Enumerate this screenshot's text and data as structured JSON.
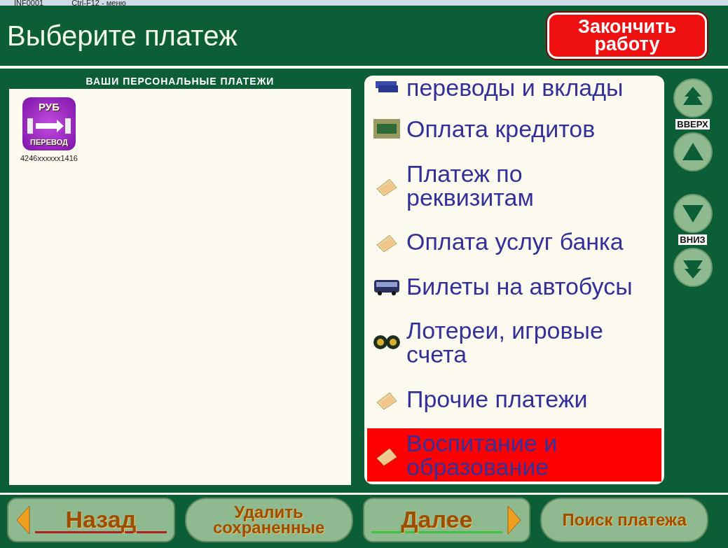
{
  "titlebar": {
    "app": "INF0001",
    "hint": "Ctrl-F12 - меню"
  },
  "header": {
    "title": "Выберите платеж",
    "finish_button": "Закончить работу"
  },
  "personal": {
    "title": "ВАШИ ПЕРСОНАЛЬНЫЕ ПЛАТЕЖИ",
    "items": [
      {
        "badge_top": "РУБ",
        "badge_bottom": "ПЕРЕВОД",
        "caption": "4246xxxxxx1416"
      }
    ]
  },
  "categories": [
    {
      "label": "переводы и вклады",
      "kind": "cards",
      "selected": false
    },
    {
      "label": "Оплата кредитов",
      "kind": "money",
      "selected": false
    },
    {
      "label": "Платеж по реквизитам",
      "kind": "folder",
      "selected": false
    },
    {
      "label": "Оплата услуг банка",
      "kind": "folder",
      "selected": false
    },
    {
      "label": "Билеты на автобусы",
      "kind": "bus",
      "selected": false
    },
    {
      "label": "Лотереи, игровые счета",
      "kind": "lottery",
      "selected": false
    },
    {
      "label": "Прочие платежи",
      "kind": "folder",
      "selected": false
    },
    {
      "label": "Воспитание и образование",
      "kind": "folder",
      "selected": true
    }
  ],
  "scroll": {
    "top_label": "ВВЕРХ",
    "bottom_label": "ВНИЗ"
  },
  "footer": [
    {
      "label": "Назад",
      "kind": "back"
    },
    {
      "label": "Удалить сохраненные",
      "kind": "plain"
    },
    {
      "label": "Далее",
      "kind": "next"
    },
    {
      "label": "Поиск платежа",
      "kind": "plain"
    }
  ]
}
